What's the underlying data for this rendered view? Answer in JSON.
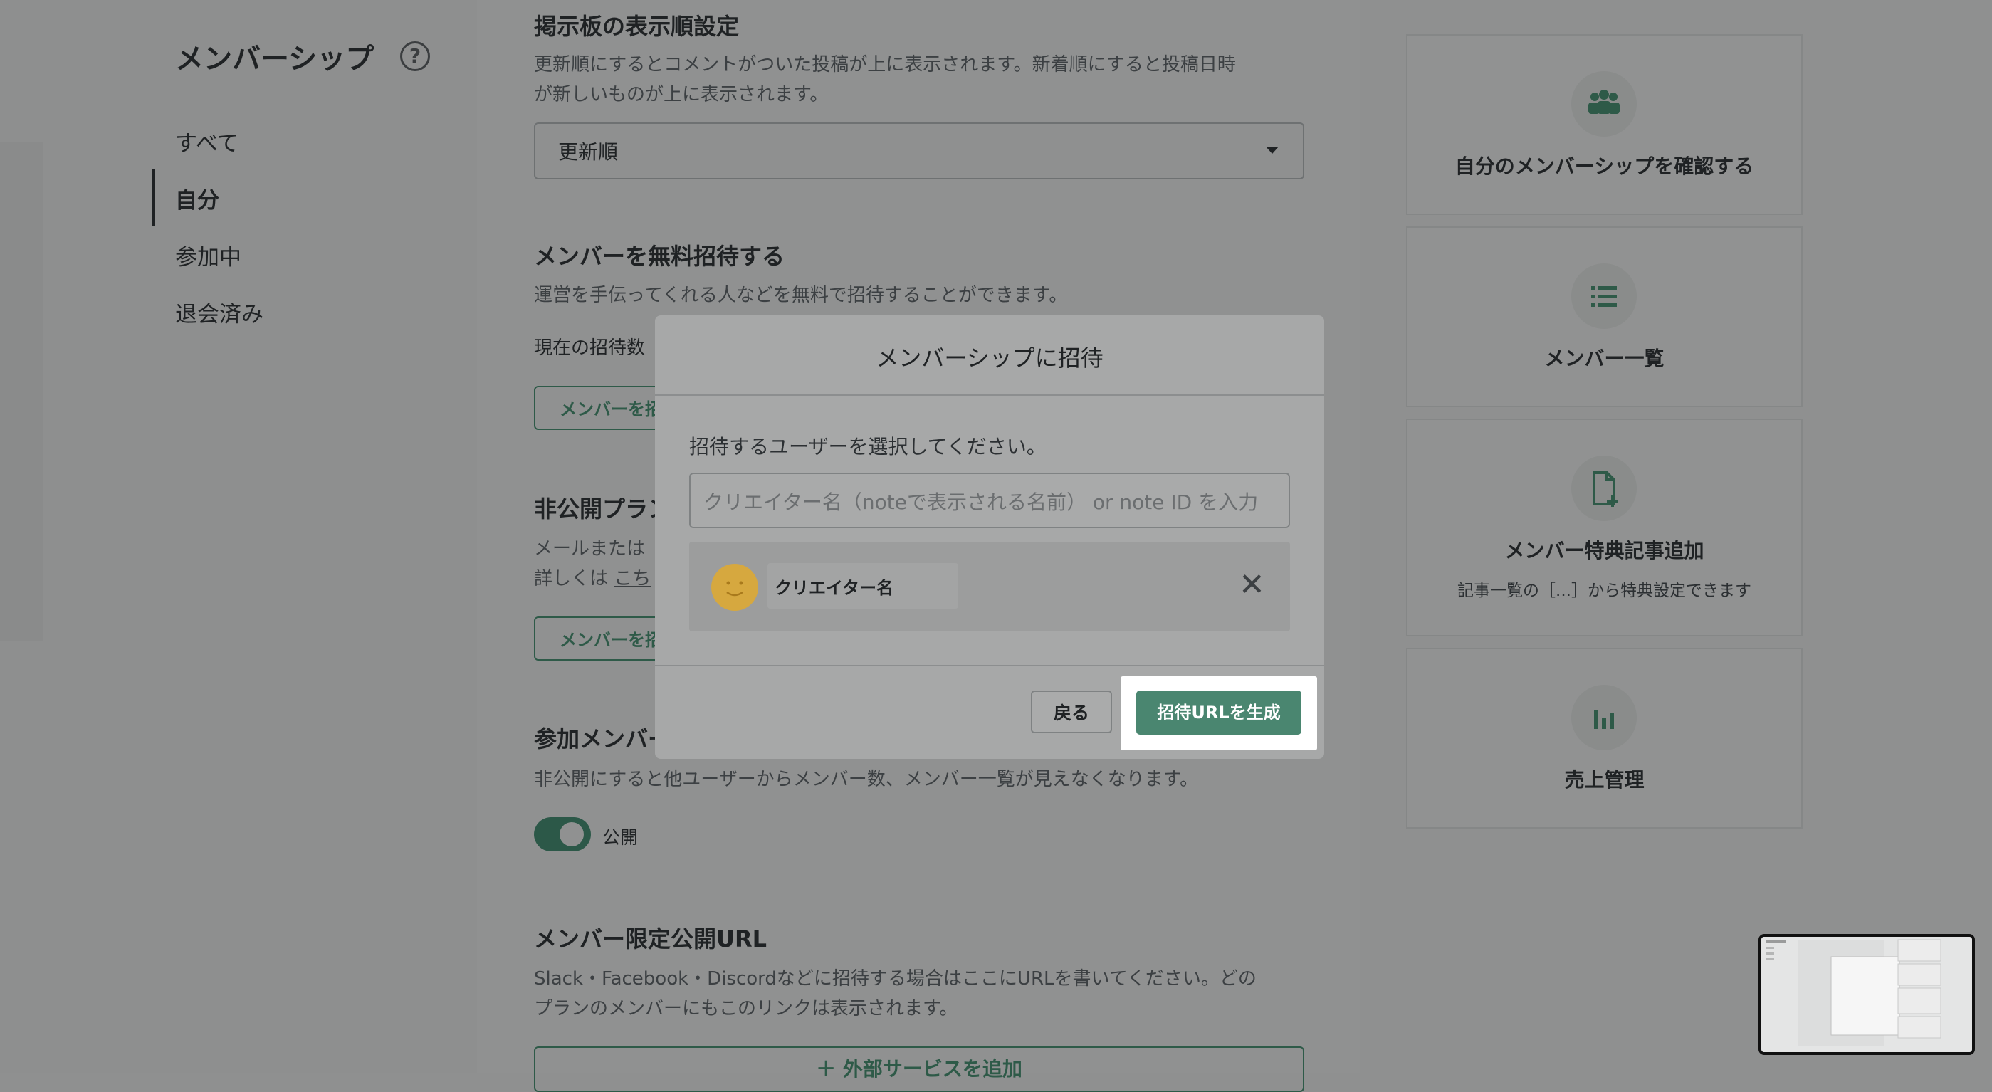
{
  "nav": {
    "title": "メンバーシップ",
    "items": [
      {
        "label": "すべて"
      },
      {
        "label": "自分"
      },
      {
        "label": "参加中"
      },
      {
        "label": "退会済み"
      }
    ]
  },
  "sections": {
    "sort": {
      "heading": "掲示板の表示順設定",
      "desc_line1": "更新順にするとコメントがついた投稿が上に表示されます。新着順にすると投稿日時",
      "desc_line2": "が新しいものが上に表示されます。",
      "select_value": "更新順"
    },
    "free_invite": {
      "heading": "メンバーを無料招待する",
      "desc": "運営を手伝ってくれる人などを無料で招待することができます。",
      "count_label": "現在の招待数",
      "button": "メンバーを招"
    },
    "private_plan": {
      "heading": "非公開プラン",
      "desc_line1": "メールまたは",
      "desc_line2_prefix": "詳しくは ",
      "desc_line2_link": "こち",
      "button": "メンバーを招"
    },
    "member_visibility": {
      "heading": "参加メンバー",
      "desc": "非公開にすると他ユーザーからメンバー数、メンバー一覧が見えなくなります。",
      "toggle_label": "公開"
    },
    "limited_url": {
      "heading": "メンバー限定公開URL",
      "desc_line1": "Slack・Facebook・Discordなどに招待する場合はここにURLを書いてください。どの",
      "desc_line2": "プランのメンバーにもこのリンクは表示されます。",
      "button": "＋ 外部サービスを追加"
    }
  },
  "cards": [
    {
      "label": "自分のメンバーシップを確認する",
      "icon": "people-group-icon"
    },
    {
      "label": "メンバー一覧",
      "icon": "list-icon"
    },
    {
      "label": "メンバー特典記事追加",
      "sub": "記事一覧の［...］から特典設定できます",
      "icon": "file-add-icon"
    },
    {
      "label": "売上管理",
      "icon": "bar-chart-icon"
    }
  ],
  "modal": {
    "title": "メンバーシップに招待",
    "prompt": "招待するユーザーを選択してください。",
    "input_placeholder": "クリエイター名（noteで表示される名前） or note ID を入力",
    "selected_user": "クリエイター名",
    "back_button": "戻る",
    "generate_button": "招待URLを生成"
  },
  "colors": {
    "accent": "#4a8670",
    "dark_accent": "#2e5a48",
    "highlight": "#ffffff"
  }
}
